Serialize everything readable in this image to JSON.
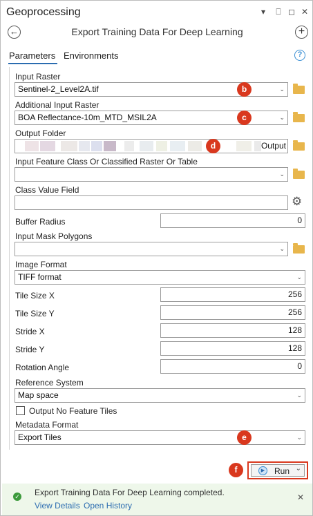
{
  "window": {
    "title": "Geoprocessing"
  },
  "tool": {
    "title": "Export Training Data For Deep Learning"
  },
  "tabs": [
    {
      "label": "Parameters"
    },
    {
      "label": "Environments"
    }
  ],
  "params": {
    "input_raster": {
      "label": "Input Raster",
      "value": "Sentinel-2_Level2A.tif"
    },
    "additional_input_raster": {
      "label": "Additional Input Raster",
      "value": "BOA Reflectance-10m_MTD_MSIL2A"
    },
    "output_folder": {
      "label": "Output Folder",
      "value": "Output"
    },
    "input_feature_class": {
      "label": "Input Feature Class Or Classified Raster Or Table",
      "value": ""
    },
    "class_value_field": {
      "label": "Class Value Field",
      "value": ""
    },
    "buffer_radius": {
      "label": "Buffer Radius",
      "value": "0"
    },
    "input_mask_polygons": {
      "label": "Input Mask Polygons",
      "value": ""
    },
    "image_format": {
      "label": "Image Format",
      "value": "TIFF format"
    },
    "tile_size_x": {
      "label": "Tile Size X",
      "value": "256"
    },
    "tile_size_y": {
      "label": "Tile Size Y",
      "value": "256"
    },
    "stride_x": {
      "label": "Stride X",
      "value": "128"
    },
    "stride_y": {
      "label": "Stride Y",
      "value": "128"
    },
    "rotation_angle": {
      "label": "Rotation Angle",
      "value": "0"
    },
    "reference_system": {
      "label": "Reference System",
      "value": "Map space"
    },
    "output_no_feature_tiles": {
      "label": "Output No Feature Tiles",
      "checked": false
    },
    "metadata_format": {
      "label": "Metadata Format",
      "value": "Export Tiles"
    }
  },
  "callouts": {
    "b": "b",
    "c": "c",
    "d": "d",
    "e": "e",
    "f": "f"
  },
  "run": {
    "label": "Run"
  },
  "status": {
    "message": "Export Training Data For Deep Learning completed.",
    "view_details": "View Details",
    "open_history": "Open History"
  },
  "colors": {
    "accent": "#2b6cb0",
    "callout": "#d9381e",
    "folder": "#e8b64c",
    "success_bg": "#eef7ea"
  }
}
